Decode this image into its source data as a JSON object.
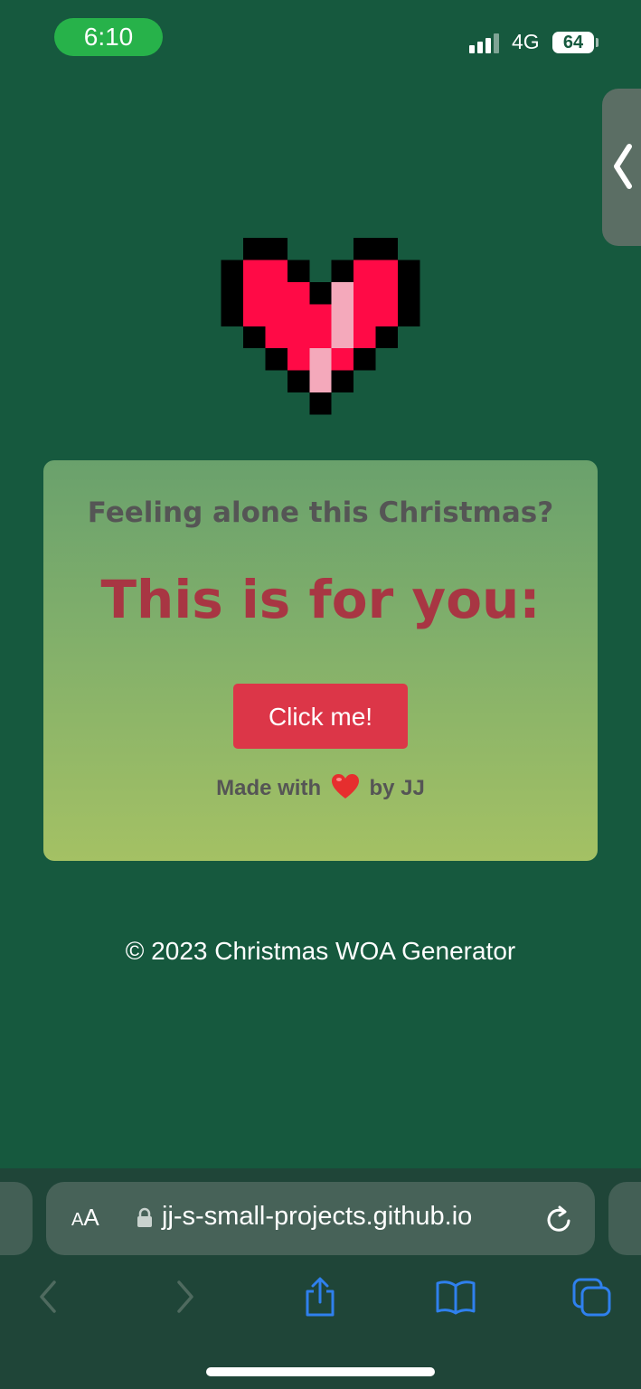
{
  "status_bar": {
    "time": "6:10",
    "network": "4G",
    "battery": "64"
  },
  "colors": {
    "page_background": "#16593e",
    "time_pill": "#27b24a",
    "heart_red": "#ff0a46",
    "heart_highlight": "#f4a9bb",
    "button": "#dc3648",
    "title": "#a83643",
    "subtitle": "#555555",
    "browser_bar": "#1f4538",
    "toolbar_accent": "#2f80ed"
  },
  "card": {
    "subtitle": "Feeling alone this Christmas?",
    "title": "This is for you:",
    "button_label": "Click me!",
    "credit_prefix": "Made with",
    "credit_suffix": "by JJ"
  },
  "footer": {
    "text": "© 2023 Christmas WOA Generator"
  },
  "browser": {
    "text_size_big": "A",
    "text_size_small": "A",
    "url": "jj-s-small-projects.github.io",
    "icons": [
      "back-icon",
      "forward-icon",
      "share-icon",
      "bookmarks-icon",
      "tabs-icon",
      "reload-icon",
      "lock-icon"
    ]
  }
}
